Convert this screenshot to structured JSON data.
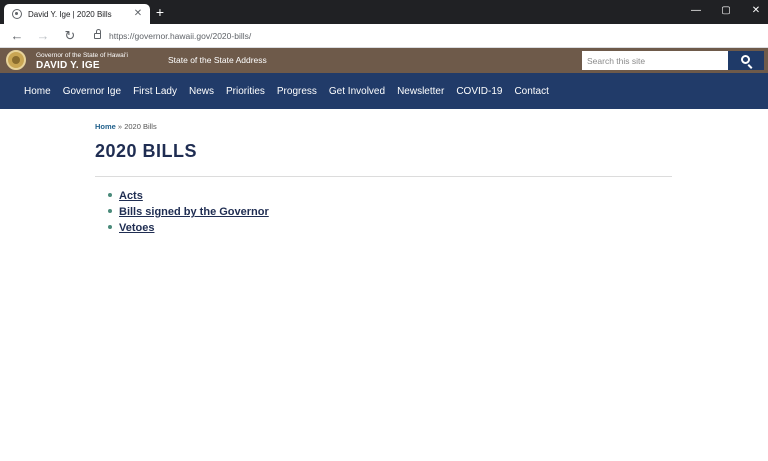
{
  "browser": {
    "tab_title": "David Y. Ige | 2020 Bills",
    "close_glyph": "✕",
    "new_tab_glyph": "+",
    "url": "https://governor.hawaii.gov/2020-bills/",
    "back_glyph": "←",
    "forward_glyph": "→",
    "reload_glyph": "↻",
    "minimize_glyph": "—",
    "maximize_glyph": "▢",
    "window_close_glyph": "✕"
  },
  "site": {
    "subtitle": "Governor of the State of Hawai'i",
    "name": "DAVID Y. IGE",
    "header_link": "State of the State Address",
    "search_placeholder": "Search this site",
    "brand_color": "#6e5a4a",
    "nav_color": "#213b69"
  },
  "nav": {
    "items": [
      "Home",
      "Governor Ige",
      "First Lady",
      "News",
      "Priorities",
      "Progress",
      "Get Involved",
      "Newsletter",
      "COVID-19",
      "Contact"
    ]
  },
  "breadcrumb": {
    "home": "Home",
    "separator": " » ",
    "current": "2020 Bills"
  },
  "page": {
    "title": "2020 BILLS",
    "links": [
      "Acts",
      "Bills signed by the Governor",
      "Vetoes"
    ]
  },
  "icons": [
    "favicon-icon",
    "lock-icon",
    "seal-icon",
    "search-icon"
  ]
}
